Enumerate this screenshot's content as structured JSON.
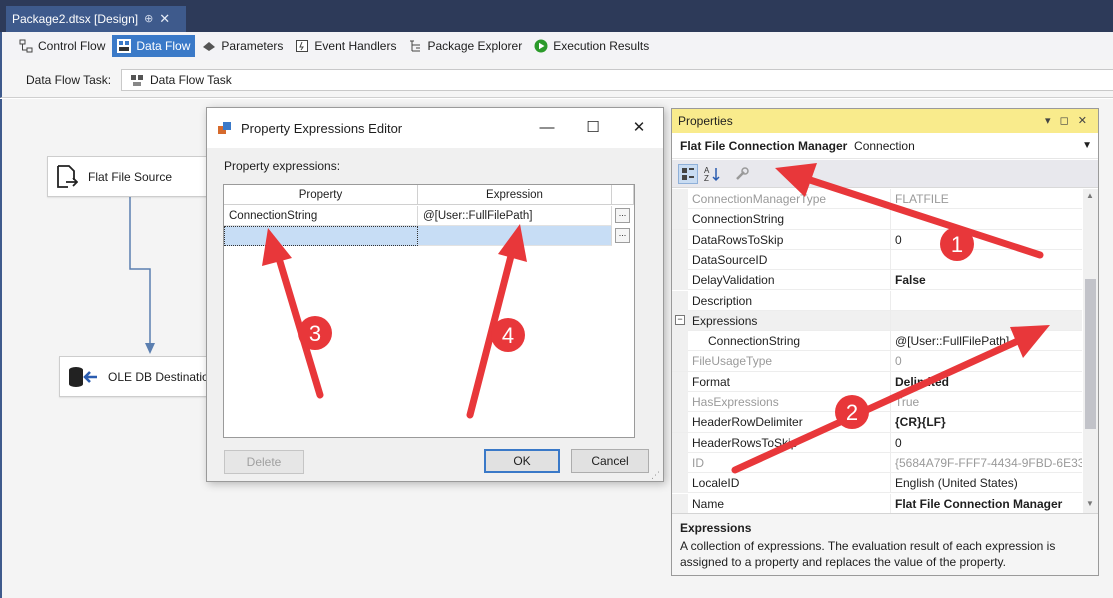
{
  "document": {
    "tab_title": "Package2.dtsx [Design]",
    "pin_glyph": "⊕",
    "close_glyph": "✕"
  },
  "designer_tabs": [
    {
      "label": "Control Flow",
      "icon": "control-flow-icon",
      "active": false
    },
    {
      "label": "Data Flow",
      "icon": "data-flow-icon",
      "active": true
    },
    {
      "label": "Parameters",
      "icon": "parameters-icon",
      "active": false
    },
    {
      "label": "Event Handlers",
      "icon": "event-handlers-icon",
      "active": false
    },
    {
      "label": "Package Explorer",
      "icon": "package-explorer-icon",
      "active": false
    },
    {
      "label": "Execution Results",
      "icon": "execution-results-icon",
      "active": false
    }
  ],
  "task_bar": {
    "label": "Data Flow Task:",
    "value": "Data Flow Task"
  },
  "canvas": {
    "components": [
      {
        "label": "Flat File Source",
        "icon": "flat-file-source-icon"
      },
      {
        "label": "OLE DB Destination",
        "icon": "ole-db-destination-icon"
      }
    ]
  },
  "dialog": {
    "title": "Property Expressions Editor",
    "minimize_glyph": "—",
    "maximize_glyph": "☐",
    "close_glyph": "✕",
    "section_label": "Property expressions:",
    "columns": {
      "property": "Property",
      "expression": "Expression"
    },
    "rows": [
      {
        "property": "ConnectionString",
        "expression": "@[User::FullFilePath]",
        "ellipsis": "..."
      },
      {
        "property": "",
        "expression": "",
        "ellipsis": "..."
      }
    ],
    "buttons": {
      "delete": "Delete",
      "ok": "OK",
      "cancel": "Cancel"
    }
  },
  "properties_panel": {
    "title": "Properties",
    "title_tools": "▾ ◻ ✕",
    "object_name": "Flat File Connection Manager",
    "object_type": "Connection",
    "rows": [
      {
        "name": "ConnectionManagerType",
        "value": "FLATFILE",
        "muted": true,
        "bold_value": false
      },
      {
        "name": "ConnectionString",
        "value": "",
        "muted": false,
        "bold_value": false
      },
      {
        "name": "DataRowsToSkip",
        "value": "0",
        "muted": false,
        "bold_value": false
      },
      {
        "name": "DataSourceID",
        "value": "",
        "muted": false,
        "bold_value": false
      },
      {
        "name": "DelayValidation",
        "value": "False",
        "muted": false,
        "bold_value": true
      },
      {
        "name": "Description",
        "value": "",
        "muted": false,
        "bold_value": false
      },
      {
        "name": "Expressions",
        "value": "",
        "muted": false,
        "bold_value": false,
        "category": true,
        "expand_glyph": "−"
      },
      {
        "name": "ConnectionString",
        "value": "@[User::FullFilePath]",
        "muted": false,
        "bold_value": false,
        "indent": true
      },
      {
        "name": "FileUsageType",
        "value": "0",
        "muted": true,
        "bold_value": false
      },
      {
        "name": "Format",
        "value": "Delimited",
        "muted": false,
        "bold_value": true
      },
      {
        "name": "HasExpressions",
        "value": "True",
        "muted": true,
        "bold_value": false
      },
      {
        "name": "HeaderRowDelimiter",
        "value": "{CR}{LF}",
        "muted": false,
        "bold_value": true
      },
      {
        "name": "HeaderRowsToSkip",
        "value": "0",
        "muted": false,
        "bold_value": false
      },
      {
        "name": "ID",
        "value": "{5684A79F-FFF7-4434-9FBD-6E33C",
        "muted": true,
        "bold_value": false
      },
      {
        "name": "LocaleID",
        "value": "English (United States)",
        "muted": false,
        "bold_value": false
      },
      {
        "name": "Name",
        "value": "Flat File Connection Manager",
        "muted": false,
        "bold_value": true
      }
    ],
    "description": {
      "title": "Expressions",
      "text": "A collection of expressions. The evaluation result of each expression is assigned to a property and replaces the value of the property."
    }
  },
  "annotations": {
    "color": "#e8373a",
    "labels": [
      "1",
      "2",
      "3",
      "4"
    ]
  }
}
